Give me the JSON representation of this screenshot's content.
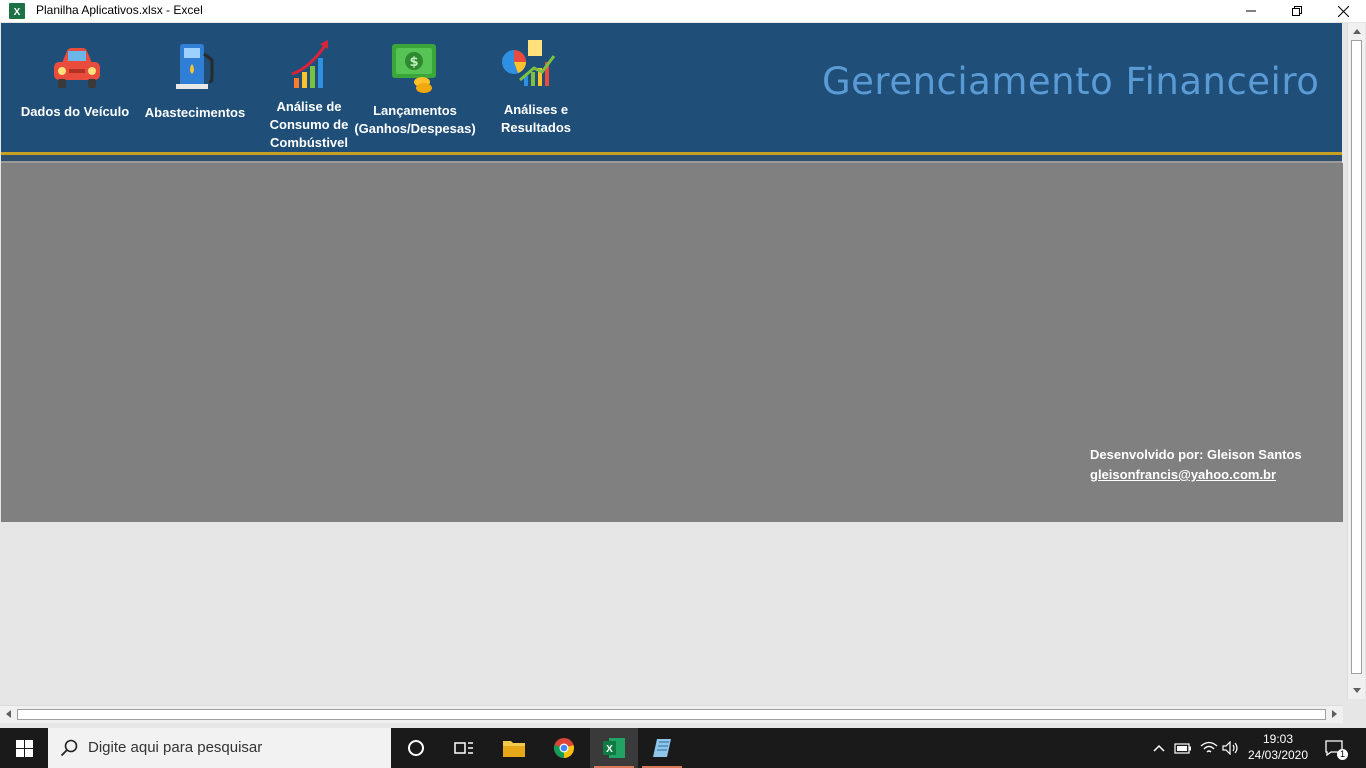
{
  "window": {
    "title": "Planilha Aplicativos.xlsx - Excel",
    "app_icon": "excel-icon"
  },
  "nav": {
    "items": [
      {
        "label": "Dados do Veículo",
        "icon": "car-icon"
      },
      {
        "label": "Abastecimentos",
        "icon": "fuel-pump-icon"
      },
      {
        "label": "Análise de\nConsumo de\nCombústivel",
        "icon": "growth-chart-icon"
      },
      {
        "label": "Lançamentos\n(Ganhos/Despesas)",
        "icon": "money-icon"
      },
      {
        "label": "Análises e\nResultados",
        "icon": "analytics-icon"
      }
    ]
  },
  "header": {
    "title": "Gerenciamento Financeiro"
  },
  "credits": {
    "developer": "Desenvolvido por: Gleison Santos",
    "email": "gleisonfrancis@yahoo.com.br"
  },
  "taskbar": {
    "search_placeholder": "Digite aqui para pesquisar",
    "time": "19:03",
    "date": "24/03/2020",
    "notification_count": "1"
  },
  "colors": {
    "header_bg": "#1f4e79",
    "header_title": "#5b9bd5",
    "accent_line": "#c8a024",
    "content_bg": "#808080"
  }
}
